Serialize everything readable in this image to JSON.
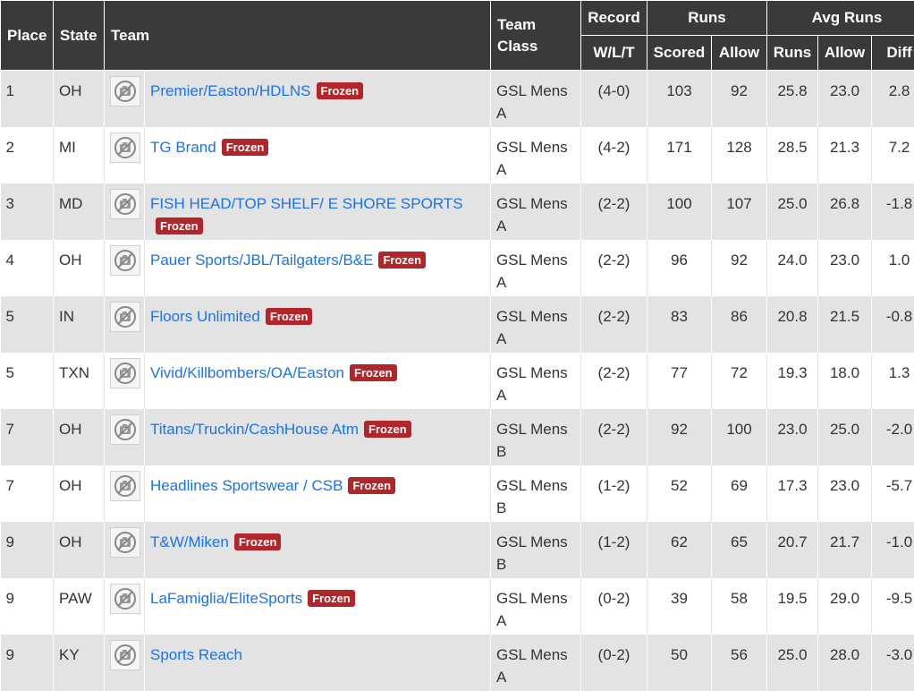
{
  "headers": {
    "place": "Place",
    "state": "State",
    "team": "Team",
    "team_class": "Team Class",
    "record": "Record",
    "wlt": "W/L/T",
    "runs": "Runs",
    "scored": "Scored",
    "allow": "Allow",
    "avg_runs": "Avg Runs",
    "avg_runs_col": "Runs",
    "avg_allow": "Allow",
    "diff": "Diff"
  },
  "badge_label": "Frozen",
  "rows": [
    {
      "place": "1",
      "state": "OH",
      "team": "Premier/Easton/HDLNS",
      "frozen": true,
      "class_line1": "GSL Mens",
      "class_line2": "A",
      "record": "(4-0)",
      "scored": "103",
      "allow": "92",
      "avg_runs": "25.8",
      "avg_allow": "23.0",
      "diff": "2.8"
    },
    {
      "place": "2",
      "state": "MI",
      "team": "TG Brand",
      "frozen": true,
      "class_line1": "GSL Mens",
      "class_line2": "A",
      "record": "(4-2)",
      "scored": "171",
      "allow": "128",
      "avg_runs": "28.5",
      "avg_allow": "21.3",
      "diff": "7.2"
    },
    {
      "place": "3",
      "state": "MD",
      "team": "FISH HEAD/TOP SHELF/ E SHORE SPORTS",
      "frozen": true,
      "class_line1": "GSL Mens",
      "class_line2": "A",
      "record": "(2-2)",
      "scored": "100",
      "allow": "107",
      "avg_runs": "25.0",
      "avg_allow": "26.8",
      "diff": "-1.8"
    },
    {
      "place": "4",
      "state": "OH",
      "team": "Pauer Sports/JBL/Tailgaters/B&E",
      "frozen": true,
      "class_line1": "GSL Mens",
      "class_line2": "A",
      "record": "(2-2)",
      "scored": "96",
      "allow": "92",
      "avg_runs": "24.0",
      "avg_allow": "23.0",
      "diff": "1.0"
    },
    {
      "place": "5",
      "state": "IN",
      "team": "Floors Unlimited",
      "frozen": true,
      "class_line1": "GSL Mens",
      "class_line2": "A",
      "record": "(2-2)",
      "scored": "83",
      "allow": "86",
      "avg_runs": "20.8",
      "avg_allow": "21.5",
      "diff": "-0.8"
    },
    {
      "place": "5",
      "state": "TXN",
      "team": "Vivid/Killbombers/OA/Easton",
      "frozen": true,
      "class_line1": "GSL Mens",
      "class_line2": "A",
      "record": "(2-2)",
      "scored": "77",
      "allow": "72",
      "avg_runs": "19.3",
      "avg_allow": "18.0",
      "diff": "1.3"
    },
    {
      "place": "7",
      "state": "OH",
      "team": "Titans/Truckin/CashHouse Atm",
      "frozen": true,
      "class_line1": "GSL Mens",
      "class_line2": "B",
      "record": "(2-2)",
      "scored": "92",
      "allow": "100",
      "avg_runs": "23.0",
      "avg_allow": "25.0",
      "diff": "-2.0"
    },
    {
      "place": "7",
      "state": "OH",
      "team": "Headlines Sportswear / CSB",
      "frozen": true,
      "class_line1": "GSL Mens",
      "class_line2": "B",
      "record": "(1-2)",
      "scored": "52",
      "allow": "69",
      "avg_runs": "17.3",
      "avg_allow": "23.0",
      "diff": "-5.7"
    },
    {
      "place": "9",
      "state": "OH",
      "team": "T&W/Miken",
      "frozen": true,
      "class_line1": "GSL Mens",
      "class_line2": "B",
      "record": "(1-2)",
      "scored": "62",
      "allow": "65",
      "avg_runs": "20.7",
      "avg_allow": "21.7",
      "diff": "-1.0"
    },
    {
      "place": "9",
      "state": "PAW",
      "team": "LaFamiglia/EliteSports",
      "frozen": true,
      "class_line1": "GSL Mens",
      "class_line2": "A",
      "record": "(0-2)",
      "scored": "39",
      "allow": "58",
      "avg_runs": "19.5",
      "avg_allow": "29.0",
      "diff": "-9.5"
    },
    {
      "place": "9",
      "state": "KY",
      "team": "Sports Reach",
      "frozen": false,
      "class_line1": "GSL Mens",
      "class_line2": "A",
      "record": "(0-2)",
      "scored": "50",
      "allow": "56",
      "avg_runs": "25.0",
      "avg_allow": "28.0",
      "diff": "-3.0"
    }
  ],
  "icons": {
    "team_logo": "no-image-camera-icon"
  },
  "colors": {
    "header_bg": "#3a3a3a",
    "row_alt": "#e3e3e3",
    "link": "#1a73e8",
    "frozen_badge": "#b0262b"
  }
}
